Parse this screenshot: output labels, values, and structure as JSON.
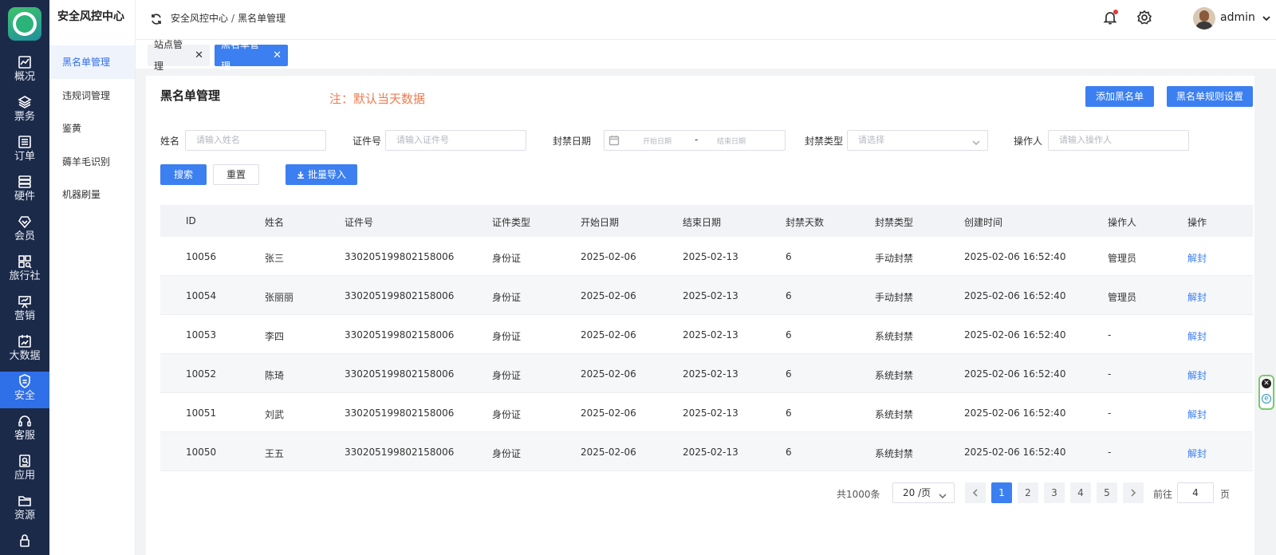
{
  "rail": {
    "items": [
      {
        "label": "概况",
        "icon": "chart-icon"
      },
      {
        "label": "票务",
        "icon": "layers-icon"
      },
      {
        "label": "订单",
        "icon": "list-icon"
      },
      {
        "label": "硬件",
        "icon": "server-icon"
      },
      {
        "label": "会员",
        "icon": "diamond-icon"
      },
      {
        "label": "旅行社",
        "icon": "grid-search-icon"
      },
      {
        "label": "营销",
        "icon": "presentation-icon"
      },
      {
        "label": "大数据",
        "icon": "calendar-chart-icon"
      },
      {
        "label": "安全",
        "icon": "shield-icon"
      },
      {
        "label": "客服",
        "icon": "headset-icon"
      },
      {
        "label": "应用",
        "icon": "document-search-icon"
      },
      {
        "label": "资源",
        "icon": "folder-icon"
      }
    ],
    "active_index": 8
  },
  "submenu": {
    "title": "安全风控中心",
    "items": [
      "黑名单管理",
      "违规词管理",
      "鉴黄",
      "薅羊毛识别",
      "机器刷量"
    ],
    "active_index": 0
  },
  "header": {
    "breadcrumb": [
      "安全风控中心",
      "黑名单管理"
    ],
    "breadcrumb_sep": "/",
    "user": "admin"
  },
  "tabs": [
    {
      "label": "站点管理",
      "active": false
    },
    {
      "label": "黑名单管理",
      "active": true
    }
  ],
  "page": {
    "title": "黑名单管理",
    "note": "注：默认当天数据",
    "add_button": "添加黑名单",
    "rules_button": "黑名单规则设置"
  },
  "filters": {
    "name_label": "姓名",
    "name_placeholder": "请输入姓名",
    "id_label": "证件号",
    "id_placeholder": "请输入证件号",
    "date_label": "封禁日期",
    "date_start": "开始日期",
    "date_sep": "-",
    "date_end": "结束日期",
    "type_label": "封禁类型",
    "type_placeholder": "请选择",
    "operator_label": "操作人",
    "operator_placeholder": "请输入操作人",
    "search": "搜索",
    "reset": "重置",
    "import": "批量导入"
  },
  "table": {
    "columns": [
      "ID",
      "姓名",
      "证件号",
      "证件类型",
      "开始日期",
      "结束日期",
      "封禁天数",
      "封禁类型",
      "创建时间",
      "操作人",
      "操作"
    ],
    "rows": [
      [
        "10056",
        "张三",
        "330205199802158006",
        "身份证",
        "2025-02-06",
        "2025-02-13",
        "6",
        "手动封禁",
        "2025-02-06 16:52:40",
        "管理员",
        "解封"
      ],
      [
        "10054",
        "张丽丽",
        "330205199802158006",
        "身份证",
        "2025-02-06",
        "2025-02-13",
        "6",
        "手动封禁",
        "2025-02-06 16:52:40",
        "管理员",
        "解封"
      ],
      [
        "10053",
        "李四",
        "330205199802158006",
        "身份证",
        "2025-02-06",
        "2025-02-13",
        "6",
        "系统封禁",
        "2025-02-06 16:52:40",
        "-",
        "解封"
      ],
      [
        "10052",
        "陈琦",
        "330205199802158006",
        "身份证",
        "2025-02-06",
        "2025-02-13",
        "6",
        "系统封禁",
        "2025-02-06 16:52:40",
        "-",
        "解封"
      ],
      [
        "10051",
        "刘武",
        "330205199802158006",
        "身份证",
        "2025-02-06",
        "2025-02-13",
        "6",
        "系统封禁",
        "2025-02-06 16:52:40",
        "-",
        "解封"
      ],
      [
        "10050",
        "王五",
        "330205199802158006",
        "身份证",
        "2025-02-06",
        "2025-02-13",
        "6",
        "系统封禁",
        "2025-02-06 16:52:40",
        "-",
        "解封"
      ]
    ]
  },
  "pagination": {
    "total": "共1000条",
    "page_size": "20 /页",
    "pages": [
      "1",
      "2",
      "3",
      "4",
      "5"
    ],
    "current": "1",
    "goto_label": "前往",
    "goto_value": "4",
    "page_suffix": "页"
  },
  "colors": {
    "rail_bg": "#1c2a4a",
    "primary": "#3c7ff0",
    "note": "#ee7b50"
  }
}
